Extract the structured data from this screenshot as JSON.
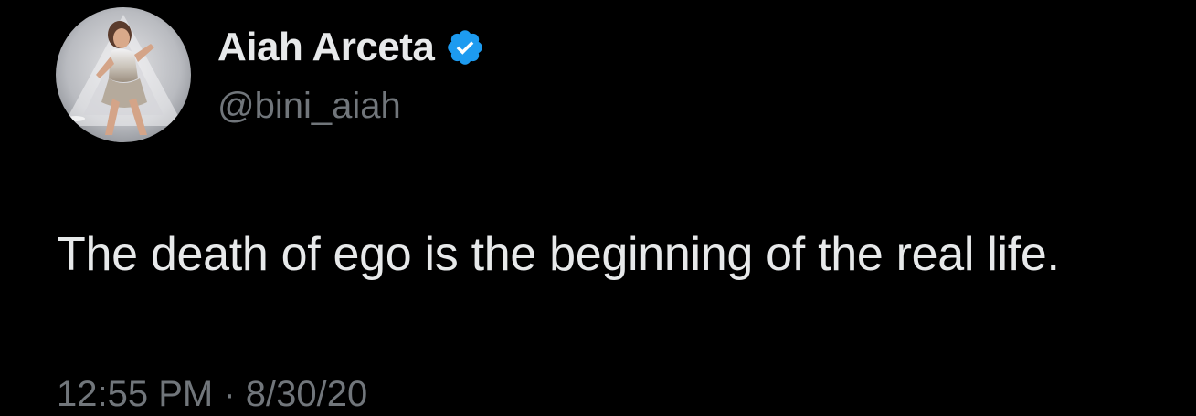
{
  "tweet": {
    "author": {
      "display_name": "Aiah Arceta",
      "handle": "@bini_aiah",
      "verified": true,
      "avatar_icon": "profile-photo"
    },
    "text": "The death of ego is the beginning of the real life.",
    "timestamp": "12:55 PM · 8/30/20"
  },
  "colors": {
    "background": "#000000",
    "primary_text": "#e7e9ea",
    "secondary_text": "#71767b",
    "verified_badge": "#1d9bf0"
  }
}
